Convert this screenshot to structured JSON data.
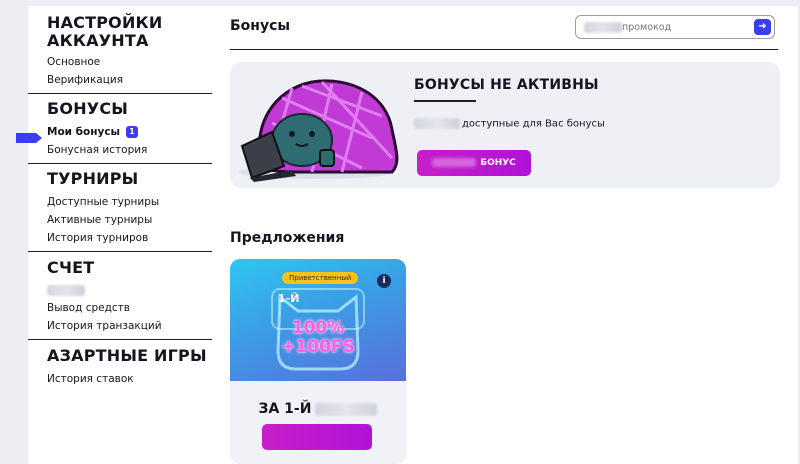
{
  "sidebar": {
    "sections": [
      {
        "title": "НАСТРОЙКИ АККАУНТА",
        "items": [
          "Основное",
          "Верификация"
        ]
      },
      {
        "title": "БОНУСЫ",
        "items": [
          "Мои бонусы",
          "Бонусная история"
        ],
        "active_badge": "1"
      },
      {
        "title": "ТУРНИРЫ",
        "items": [
          "Доступные турниры",
          "Активные турниры",
          "История турниров"
        ]
      },
      {
        "title": "СЧЕТ",
        "items": [
          "Вывод средств",
          "История транзакций"
        ]
      },
      {
        "title": "АЗАРТНЫЕ ИГРЫ",
        "items": [
          "История ставок"
        ]
      }
    ]
  },
  "main": {
    "title": "Бонусы",
    "promo": {
      "placeholder": "промокод",
      "submit_icon": "arrow-right-icon"
    },
    "bonus_card": {
      "title": "БОНУСЫ НЕ АКТИВНЫ",
      "text": "доступные для Вас бонусы",
      "button_label": "БОНУС"
    },
    "offers": {
      "title": "Предложения",
      "card": {
        "tag": "Приветственный",
        "deposit_label": "1-Й",
        "percent": "100%",
        "freespins": "+100FS",
        "name": "ЗА 1-Й"
      }
    }
  },
  "colors": {
    "accent": "#3a3df0",
    "button": "#c81fc8",
    "card_bg": "#eef0f6"
  }
}
